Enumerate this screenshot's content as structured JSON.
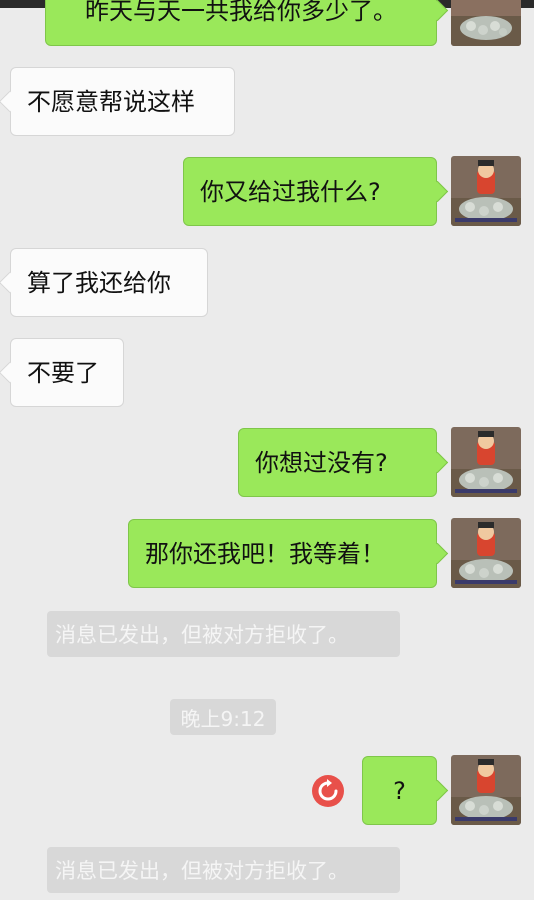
{
  "messages": [
    {
      "side": "out",
      "text": "昨天与天一共我给你多少了。"
    },
    {
      "side": "in",
      "text": "不愿意帮说这样"
    },
    {
      "side": "out",
      "text": "你又给过我什么?"
    },
    {
      "side": "in",
      "text": "算了我还给你"
    },
    {
      "side": "in",
      "text": "不要了"
    },
    {
      "side": "out",
      "text": "你想过没有?"
    },
    {
      "side": "out",
      "text": "那你还我吧！我等着！"
    },
    {
      "side": "out",
      "text": "?"
    }
  ],
  "system": {
    "rejected_notice": "消息已发出，但被对方拒收了。",
    "timestamp": "晚上9:12"
  },
  "icons": {
    "resend": "refresh-icon",
    "avatar": "user-avatar"
  },
  "colors": {
    "background": "#ebebeb",
    "outgoing_bubble": "#9ae85a",
    "incoming_bubble": "#fbfbfb",
    "notice_bg": "#d8d8d8",
    "resend_red": "#e8504a"
  }
}
